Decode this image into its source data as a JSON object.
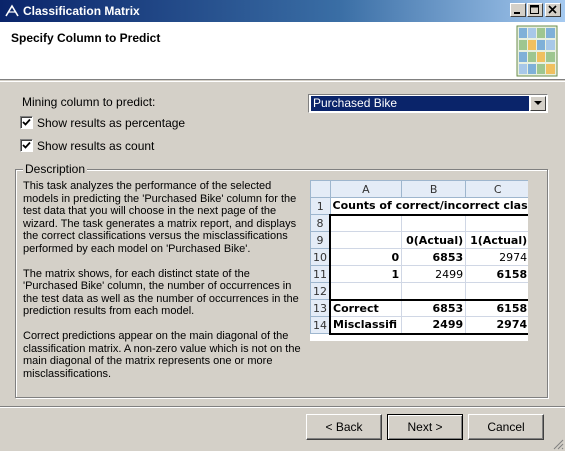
{
  "window": {
    "title": "Classification Matrix"
  },
  "header": {
    "title": "Specify Column to Predict"
  },
  "form": {
    "mining_label": "Mining column to predict:",
    "selected_column": "Purchased Bike",
    "show_percentage": {
      "label": "Show results as percentage",
      "checked": true
    },
    "show_count": {
      "label": "Show results as count",
      "checked": true
    }
  },
  "description": {
    "legend": "Description",
    "paragraphs": [
      "This task analyzes the performance of the selected models in predicting the 'Purchased Bike' column for the test data that you will choose in the next page of the wizard. The task generates a matrix report, and displays the correct classifications versus the misclassifications performed by each model on 'Purchased Bike'.",
      "The matrix shows, for each distinct state of the 'Purchased Bike' column, the number of occurrences in the test data as well as the number of occurrences in the prediction results from each model.",
      "Correct predictions appear on the main diagonal of the classification matrix. A non-zero value which is not on the main diagonal of the matrix represents one or more misclassifications."
    ]
  },
  "sheet": {
    "columns": [
      "A",
      "B",
      "C"
    ],
    "rows": [
      {
        "num": "1",
        "a": "Counts of correct/incorrect clas",
        "b": "",
        "c": ""
      },
      {
        "num": "8",
        "a": "",
        "b": "",
        "c": ""
      },
      {
        "num": "9",
        "a": "",
        "b": "0(Actual)",
        "c": "1(Actual)"
      },
      {
        "num": "10",
        "a": "0",
        "b": "6853",
        "c": "2974"
      },
      {
        "num": "11",
        "a": "1",
        "b": "2499",
        "c": "6158"
      },
      {
        "num": "12",
        "a": "",
        "b": "",
        "c": ""
      },
      {
        "num": "13",
        "a": "Correct",
        "b": "6853",
        "c": "6158"
      },
      {
        "num": "14",
        "a": "Misclassifi",
        "b": "2499",
        "c": "2974"
      }
    ]
  },
  "buttons": {
    "back": "< Back",
    "next": "Next >",
    "cancel": "Cancel"
  },
  "icons": {
    "app": "classification-icon",
    "logo": "matrix-grid-icon"
  },
  "colors": {
    "title_bar": "#0a246a",
    "selection": "#0a246a",
    "face": "#d4d0c8"
  }
}
